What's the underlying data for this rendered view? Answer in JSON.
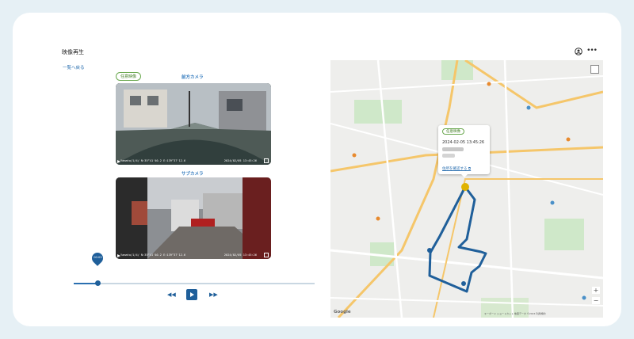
{
  "app": {
    "title": "映像再生",
    "back_link": "一覧へ戻る"
  },
  "left": {
    "tag": "任意映像",
    "front_label": "前方カメラ",
    "sub_label": "サブカメラ",
    "front_stamp": "Yamato/1/4/ N:35°41'40.2 E:139°37'12.6 ",
    "front_date": "2024/02/05 13:45:26",
    "sub_stamp": "Yamato/1/4/ N:35°41'40.2 E:139°37'12.6 ",
    "sub_date": "2024/02/05 13:45:26",
    "time_bubble": "00:03",
    "progress": 0.1
  },
  "map": {
    "popup_tag": "任意映像",
    "popup_date": "2024-02-05 13:45:26",
    "popup_link": "住所を確認する ⧉",
    "google": "Google",
    "attrib": "キーボード ショートカット  地図データ ©2024  利用規約",
    "zoom_in": "+",
    "zoom_out": "−"
  },
  "colors": {
    "route": "#1f5f9a",
    "accent": "#2a6fb0",
    "tag_green": "#6aa84f"
  }
}
